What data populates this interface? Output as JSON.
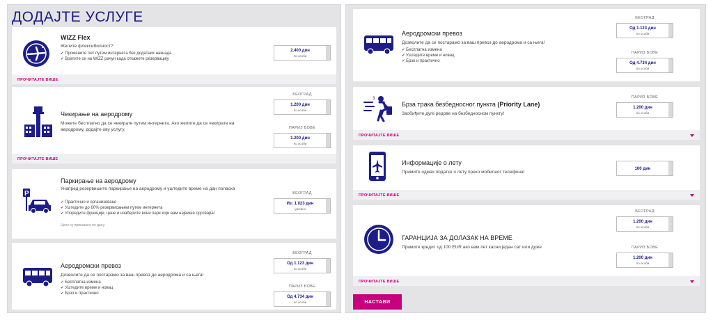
{
  "page_title": "ДОДАЈТЕ УСЛУГЕ",
  "read_more": "ПРОЧИТАЈТЕ ВИШЕ",
  "continue_label": "НАСТАВИ",
  "per_person": "по особи",
  "colors": {
    "primary": "#1d1d88",
    "accent": "#c6007e",
    "background": "#e4e4e6"
  },
  "left": {
    "flex": {
      "title": "WIZZ Flex",
      "subtitle": "Желите флексибилност?",
      "bullets": [
        "Промените лет путем интернета без додатних накнада",
        "Вратите се на WIZZ рачун када откажете резервацију"
      ],
      "price": "2.400 дин",
      "icon": "plane-circle-icon"
    },
    "checkin": {
      "title": "Чекирање на аеродрому",
      "desc": "Можете бесплатно да се чекирате путем интернета. Ако желите да се чекирате на аеродрому, додајте ову услугу.",
      "loc1": "БЕОГРАД",
      "price1": "1.200 дин",
      "loc2": "ПАРИЗ БОВЕ",
      "price2": "1.200 дин",
      "icon": "airport-tower-icon"
    },
    "parking": {
      "title": "Паркирање на аеродрому",
      "desc": "Унапред резервишите паркирање на аеродрому и уштедите време на дан поласка",
      "bullets": [
        "Практично и организовано",
        "Уштедите до 60% резервисањем путем интернета",
        "Упоредите функције, цене и изаберите вони парк који вам највише одговара!"
      ],
      "note": "Цене су приказане по дану.",
      "loc1": "БЕОГРАД",
      "price1": "Из: 1.023 дин",
      "price1_sub": "/дневно",
      "icon": "parking-car-icon"
    },
    "transfer": {
      "title": "Аеродромски превоз",
      "desc": "Дозволите да се постарамо за ваш превоз до аеродрома и са њега!",
      "bullets": [
        "Бесплатна измена",
        "Уштедите време и новац",
        "Брзо и практично"
      ],
      "loc1": "БЕОГРАД",
      "price1": "Од 1.123 дин",
      "loc2": "ПАРИЗ БОВЕ",
      "price2": "Од 4.734 дин",
      "icon": "bus-icon"
    }
  },
  "right": {
    "transfer": {
      "title": "Аеродромски превоз",
      "desc": "Дозволите да се постарамо за ваш превоз до аеродрома и са њега!",
      "bullets": [
        "Бесплатна измена",
        "Уштедите време и новац",
        "Брзо и практично"
      ],
      "loc1": "БЕОГРАД",
      "price1": "Од 1.123 дин",
      "loc2": "ПАРИЗ БОВЕ",
      "price2": "Од 4.734 дин",
      "icon": "bus-icon"
    },
    "priority": {
      "title": "Брза трака безбедносног пункта",
      "title_bold": "(Priority Lane)",
      "desc": "Заобиђите дуге редове на безбедносном пункту!",
      "loc1": "ПАРИЗ БОВЕ",
      "price1": "1.200 дин",
      "icon": "running-traveler-icon"
    },
    "flightinfo": {
      "title": "Информације о лету",
      "desc": "Примите одмах податке о лету преко мобилног телефона!",
      "price1": "100 дин",
      "icon": "phone-plane-icon"
    },
    "guarantee": {
      "title": "ГАРАНЦИЈА ЗА ДОЛАЗАК НА ВРЕМЕ",
      "desc": "Примите кредит од 100 EUR ако вам лет касни један сат или дуже",
      "loc1": "БЕОГРАД",
      "price1": "1.200 дин",
      "loc2": "ПАРИЗ БОВЕ",
      "price2": "1.200 дин",
      "icon": "clock-icon"
    }
  }
}
